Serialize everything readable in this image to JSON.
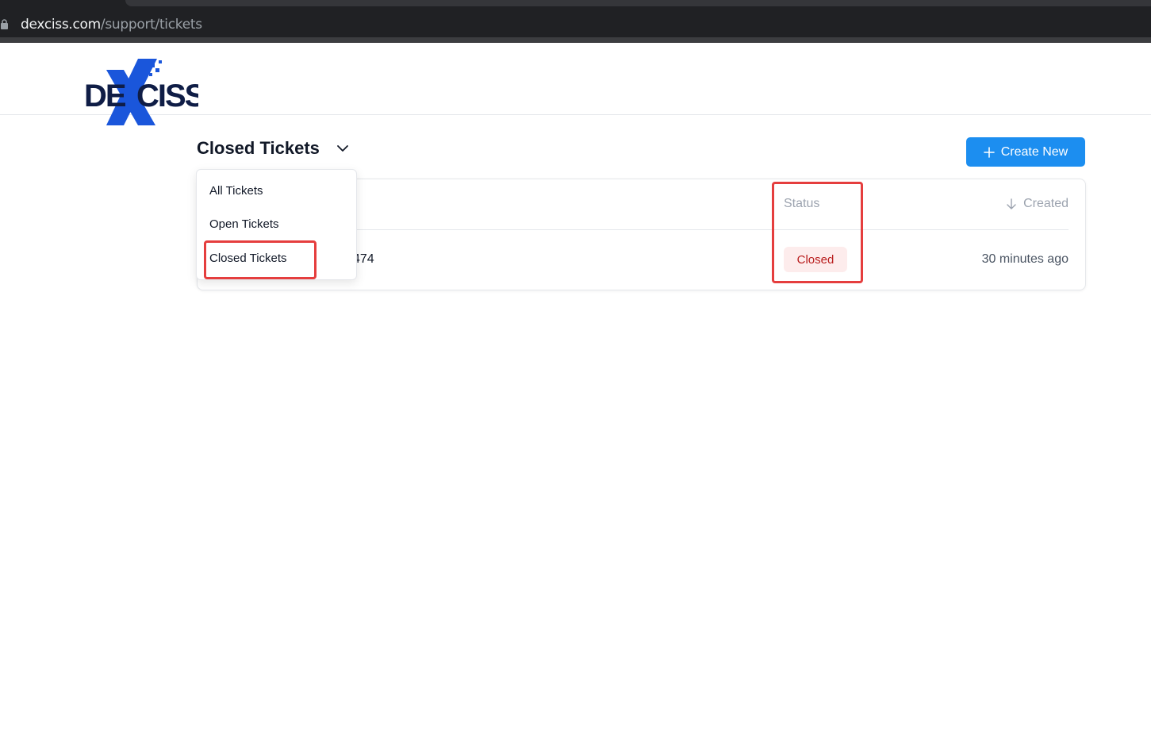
{
  "browser": {
    "url_host": "dexciss.com",
    "url_path": "/support/tickets",
    "icons": {
      "lock": "lock-icon"
    }
  },
  "header": {
    "logo_text": "DEXCISS",
    "logo_colors": {
      "dark": "#0f1d46",
      "blue": "#1a56db"
    }
  },
  "page": {
    "title": "Closed Tickets",
    "create_button_label": "Create New",
    "accent_color": "#1c8ef0"
  },
  "dropdown": {
    "items": [
      {
        "label": "All Tickets"
      },
      {
        "label": "Open Tickets"
      },
      {
        "label": "Closed Tickets"
      }
    ],
    "selected": "Closed Tickets"
  },
  "table": {
    "columns": {
      "status": "Status",
      "created": "Created"
    },
    "sort": "descending",
    "rows": [
      {
        "id_visible": "474",
        "status": "Closed",
        "created": "30 minutes ago"
      }
    ]
  },
  "annotations": {
    "highlight_color": "#e53e3e"
  }
}
